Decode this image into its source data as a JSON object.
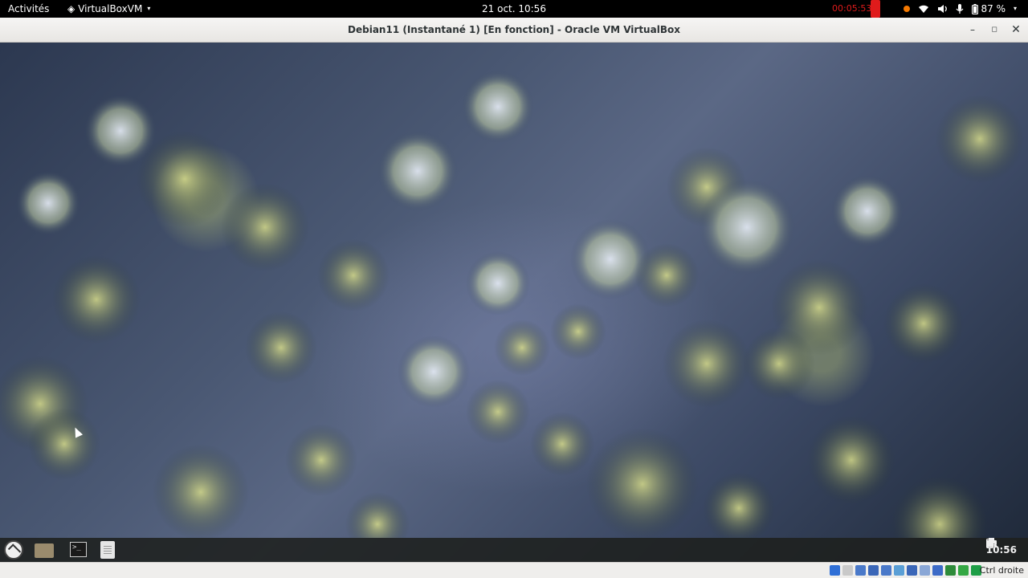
{
  "topbar": {
    "activities": "Activités",
    "app_name": "VirtualBoxVM",
    "app_arrow": "▾",
    "clock": "21 oct.  10:56",
    "recording_time": "00:05:53",
    "battery": "87 %",
    "icons": [
      "record-icon",
      "notification-dot-icon",
      "wifi-icon",
      "volume-icon",
      "microphone-icon",
      "battery-icon",
      "power-menu-icon"
    ]
  },
  "window": {
    "title": "Debian11 (Instantané 1) [En fonction] - Oracle VM VirtualBox",
    "minimize": "–",
    "maximize": "◻",
    "close": "✕"
  },
  "guest_panel": {
    "terminal_glyph": ">_",
    "time": "10:56",
    "tray_icons": [
      "printer-icon",
      "network-icon",
      "volume-icon",
      "battery-icon"
    ]
  },
  "statusbar": {
    "host_key": "Ctrl droite",
    "icons": [
      "hard-disk-icon",
      "optical-drive-icon",
      "audio-icon",
      "network-icon",
      "usb-icon",
      "shared-folders-icon",
      "display-icon",
      "video-capture-icon",
      "clipboard-icon",
      "recording-icon",
      "cpu-icon",
      "mouse-integration-icon"
    ],
    "icon_colors": [
      "#2f6fd6",
      "#c9c9c9",
      "#4a79c9",
      "#3b67b8",
      "#4a79c9",
      "#5a9fd6",
      "#3b67b8",
      "#8aa7d6",
      "#3d6bc7",
      "#2e8b3a",
      "#35a844",
      "#1e9e46"
    ]
  },
  "colors": {
    "accent_record": "#e01b1b",
    "notification": "#f57900"
  }
}
